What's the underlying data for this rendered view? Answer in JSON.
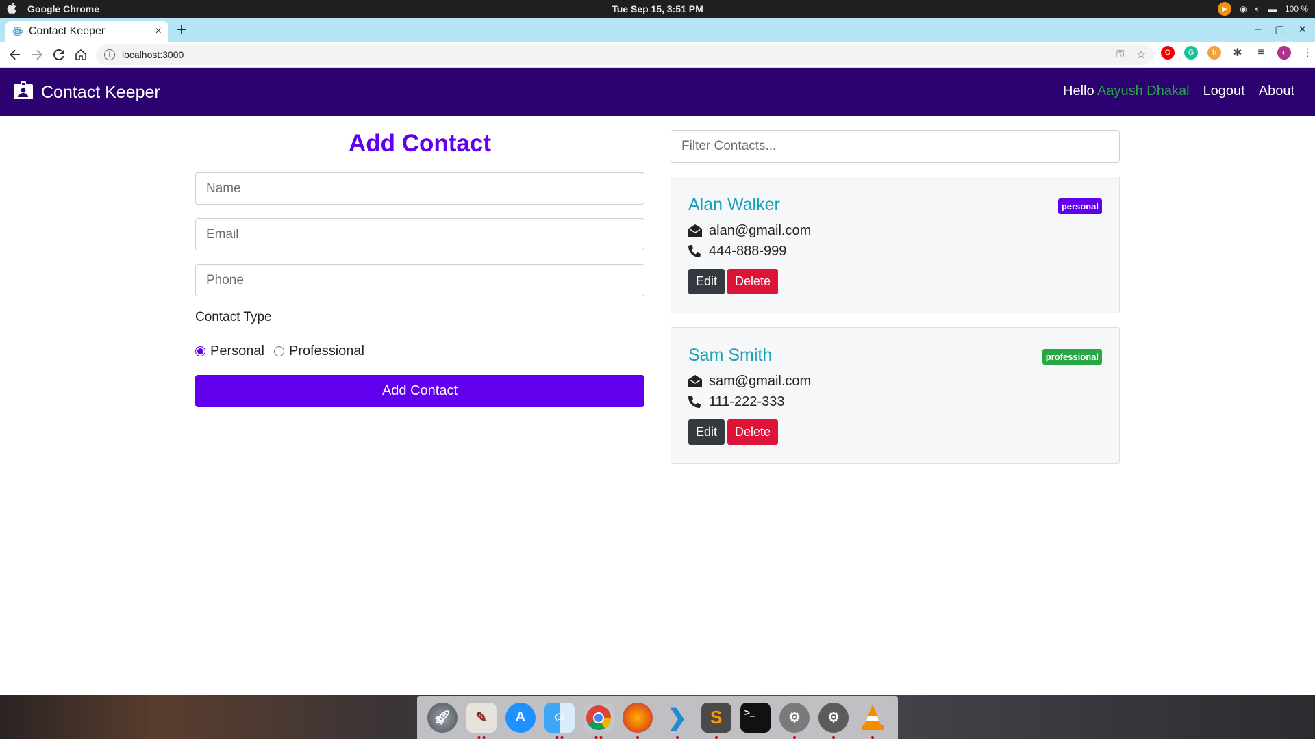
{
  "os": {
    "app_name": "Google Chrome",
    "clock": "Tue Sep 15,  3:51 PM",
    "battery": "100 %",
    "icons": [
      "apple-icon",
      "media-play-icon",
      "eye-icon",
      "volume-icon",
      "battery-icon"
    ]
  },
  "browser": {
    "tab_title": "Contact Keeper",
    "tab_close": "×",
    "new_tab": "+",
    "url": "localhost:3000",
    "window_controls": [
      "‒",
      "▢",
      "✕"
    ]
  },
  "navbar": {
    "brand": "Contact Keeper",
    "hello": "Hello",
    "user_name": "Aayush Dhakal",
    "logout": "Logout",
    "about": "About",
    "bg_color": "#2b0270",
    "accent_green": "#28a745"
  },
  "form": {
    "title": "Add Contact",
    "name_placeholder": "Name",
    "email_placeholder": "Email",
    "phone_placeholder": "Phone",
    "contact_type_label": "Contact Type",
    "radio_personal": "Personal",
    "radio_professional": "Professional",
    "selected_type": "personal",
    "submit": "Add Contact",
    "primary_color": "#6200ee"
  },
  "contacts": {
    "filter_placeholder": "Filter Contacts...",
    "items": [
      {
        "name": "Alan Walker",
        "type": "personal",
        "email": "alan@gmail.com",
        "phone": "444-888-999",
        "edit": "Edit",
        "delete": "Delete"
      },
      {
        "name": "Sam Smith",
        "type": "professional",
        "email": "sam@gmail.com",
        "phone": "111-222-333",
        "edit": "Edit",
        "delete": "Delete"
      }
    ]
  },
  "dock": {
    "apps": [
      "launchpad",
      "script-editor",
      "app-store",
      "finder",
      "chrome",
      "firefox",
      "vscode",
      "sublime-text",
      "terminal",
      "disk-utility",
      "system-preferences",
      "vlc"
    ]
  }
}
